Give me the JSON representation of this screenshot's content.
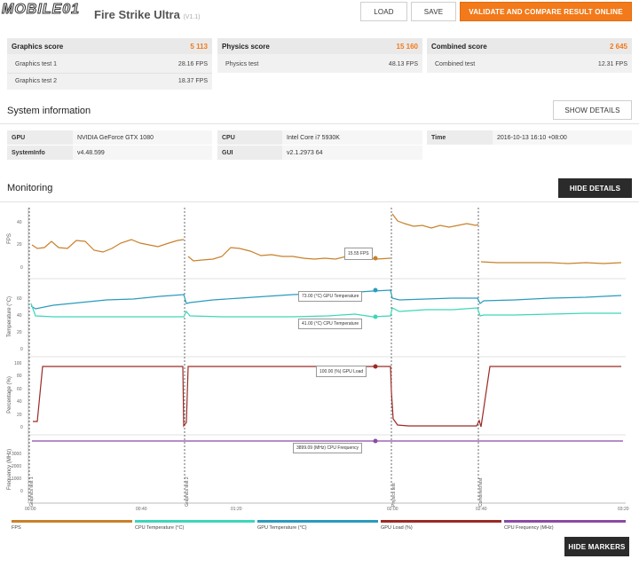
{
  "header": {
    "logo_text": "MOBILE01",
    "title_partial": "Fire Strike Ultra",
    "version": "(V1.1)",
    "load_label": "LOAD",
    "save_label": "SAVE",
    "validate_label": "VALIDATE AND COMPARE RESULT ONLINE"
  },
  "scores": [
    {
      "title": "Graphics score",
      "value": "5 113",
      "rows": [
        {
          "label": "Graphics test 1",
          "value": "28.16 FPS"
        },
        {
          "label": "Graphics test 2",
          "value": "18.37 FPS"
        }
      ]
    },
    {
      "title": "Physics score",
      "value": "15 160",
      "rows": [
        {
          "label": "Physics test",
          "value": "48.13 FPS"
        }
      ]
    },
    {
      "title": "Combined score",
      "value": "2 645",
      "rows": [
        {
          "label": "Combined test",
          "value": "12.31 FPS"
        }
      ]
    }
  ],
  "system": {
    "heading": "System information",
    "show_details": "SHOW DETAILS",
    "gpu_key": "GPU",
    "gpu_val": "NVIDIA GeForce GTX 1080",
    "sysinfo_key": "SystemInfo",
    "sysinfo_val": "v4.48.599",
    "cpu_key": "CPU",
    "cpu_val": "Intel Core i7 5930K",
    "gui_key": "GUI",
    "gui_val": "v2.1.2973 64",
    "time_key": "Time",
    "time_val": "2016-10-13 16:10 +08:00"
  },
  "monitoring": {
    "heading": "Monitoring",
    "hide_details": "HIDE DETAILS",
    "hide_markers": "HIDE MARKERS",
    "y_titles": [
      "FPS",
      "Temperature (°C)",
      "Percentage (%)",
      "Frequency (MHz)"
    ],
    "fps_ticks": [
      "40",
      "20",
      "0"
    ],
    "temp_ticks": [
      "60",
      "40",
      "20",
      "0"
    ],
    "pct_ticks": [
      "100",
      "80",
      "60",
      "40",
      "20",
      "0"
    ],
    "freq_ticks": [
      "3000",
      "2000",
      "1000",
      "0"
    ],
    "x_ticks": [
      "00:00",
      "00:40",
      "01:20",
      "02:00",
      "02:40",
      "03:20"
    ],
    "markers": [
      "Graphics test 1",
      "Graphics test 2",
      "Physics test",
      "Combined test"
    ],
    "tooltips": {
      "fps": "15.55 FPS",
      "gpu_temp": "73.00 (°C) GPU Temperature",
      "cpu_temp": "41.00 (°C) CPU Temperature",
      "gpu_load": "100.00 (%) GPU Load",
      "cpu_freq": "3899.09 (MHz) CPU Frequency"
    },
    "legend": [
      {
        "label": "FPS",
        "color": "#c8812a"
      },
      {
        "label": "CPU Temperature (°C)",
        "color": "#3ed6b8"
      },
      {
        "label": "GPU Temperature (°C)",
        "color": "#2a9bbd"
      },
      {
        "label": "GPU Load (%)",
        "color": "#9a2a25"
      },
      {
        "label": "CPU Frequency (MHz)",
        "color": "#8a4aa6"
      }
    ]
  }
}
